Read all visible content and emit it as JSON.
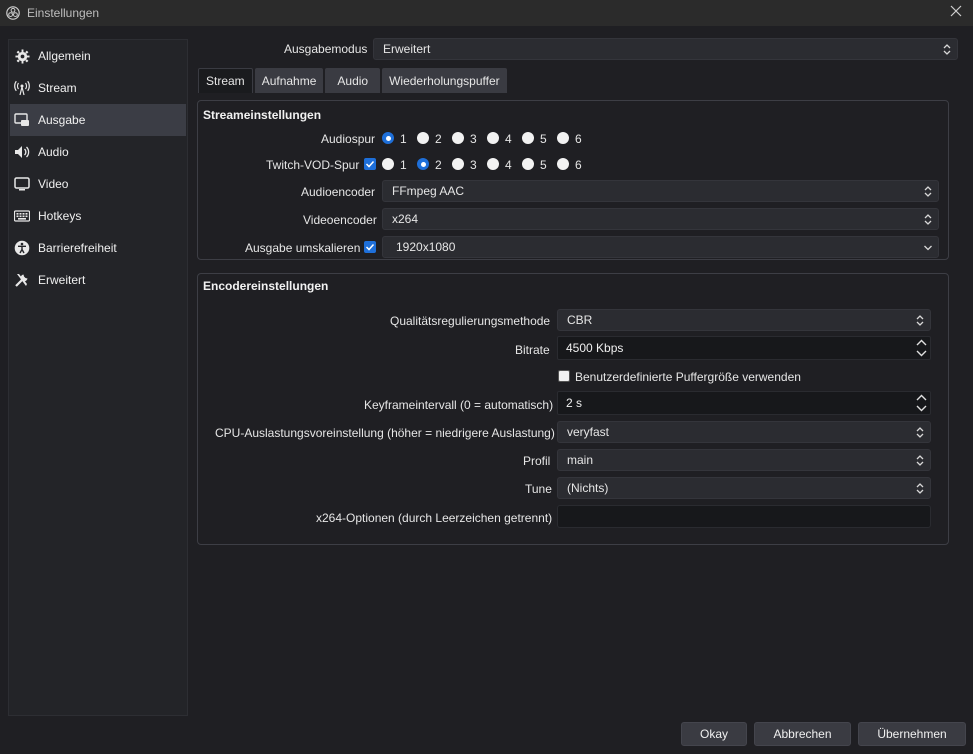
{
  "window": {
    "title": "Einstellungen",
    "app_icon": "obs-icon",
    "close_icon": "close-icon"
  },
  "sidebar": {
    "items": [
      {
        "label": "Allgemein",
        "icon": "gear-icon",
        "active": false
      },
      {
        "label": "Stream",
        "icon": "broadcast-icon",
        "active": false
      },
      {
        "label": "Ausgabe",
        "icon": "output-icon",
        "active": true
      },
      {
        "label": "Audio",
        "icon": "speaker-icon",
        "active": false
      },
      {
        "label": "Video",
        "icon": "monitor-icon",
        "active": false
      },
      {
        "label": "Hotkeys",
        "icon": "keyboard-icon",
        "active": false
      },
      {
        "label": "Barrierefreiheit",
        "icon": "accessibility-icon",
        "active": false
      },
      {
        "label": "Erweitert",
        "icon": "tools-icon",
        "active": false
      }
    ]
  },
  "output_mode": {
    "label": "Ausgabemodus",
    "value": "Erweitert"
  },
  "tabs": [
    {
      "label": "Stream",
      "active": true
    },
    {
      "label": "Aufnahme",
      "active": false
    },
    {
      "label": "Audio",
      "active": false
    },
    {
      "label": "Wiederholungspuffer",
      "active": false
    }
  ],
  "stream_settings": {
    "title": "Streameinstellungen",
    "audio_track": {
      "label": "Audiospur",
      "options": [
        "1",
        "2",
        "3",
        "4",
        "5",
        "6"
      ],
      "selected": "1"
    },
    "twitch_vod": {
      "label": "Twitch-VOD-Spur",
      "checked": true,
      "options": [
        "1",
        "2",
        "3",
        "4",
        "5",
        "6"
      ],
      "selected": "2"
    },
    "audio_encoder": {
      "label": "Audioencoder",
      "value": "FFmpeg AAC"
    },
    "video_encoder": {
      "label": "Videoencoder",
      "value": "x264"
    },
    "rescale": {
      "label": "Ausgabe umskalieren",
      "checked": true,
      "value": "1920x1080"
    }
  },
  "encoder_settings": {
    "title": "Encodereinstellungen",
    "rate_control": {
      "label": "Qualitätsregulierungsmethode",
      "value": "CBR"
    },
    "bitrate": {
      "label": "Bitrate",
      "value": "4500 Kbps"
    },
    "custom_buffer": {
      "label": "Benutzerdefinierte Puffergröße verwenden",
      "checked": false
    },
    "keyframe": {
      "label": "Keyframeintervall (0 = automatisch)",
      "value": "2 s"
    },
    "cpu_preset": {
      "label": "CPU-Auslastungsvoreinstellung (höher = niedrigere Auslastung)",
      "value": "veryfast"
    },
    "profile": {
      "label": "Profil",
      "value": "main"
    },
    "tune": {
      "label": "Tune",
      "value": "(Nichts)"
    },
    "x264_options": {
      "label": "x264-Optionen (durch Leerzeichen getrennt)",
      "value": ""
    }
  },
  "buttons": {
    "ok": "Okay",
    "cancel": "Abbrechen",
    "apply": "Übernehmen"
  },
  "colors": {
    "accent": "#1e6fd9",
    "background": "#1f1f23",
    "sidebar_active": "#3b3d45"
  }
}
